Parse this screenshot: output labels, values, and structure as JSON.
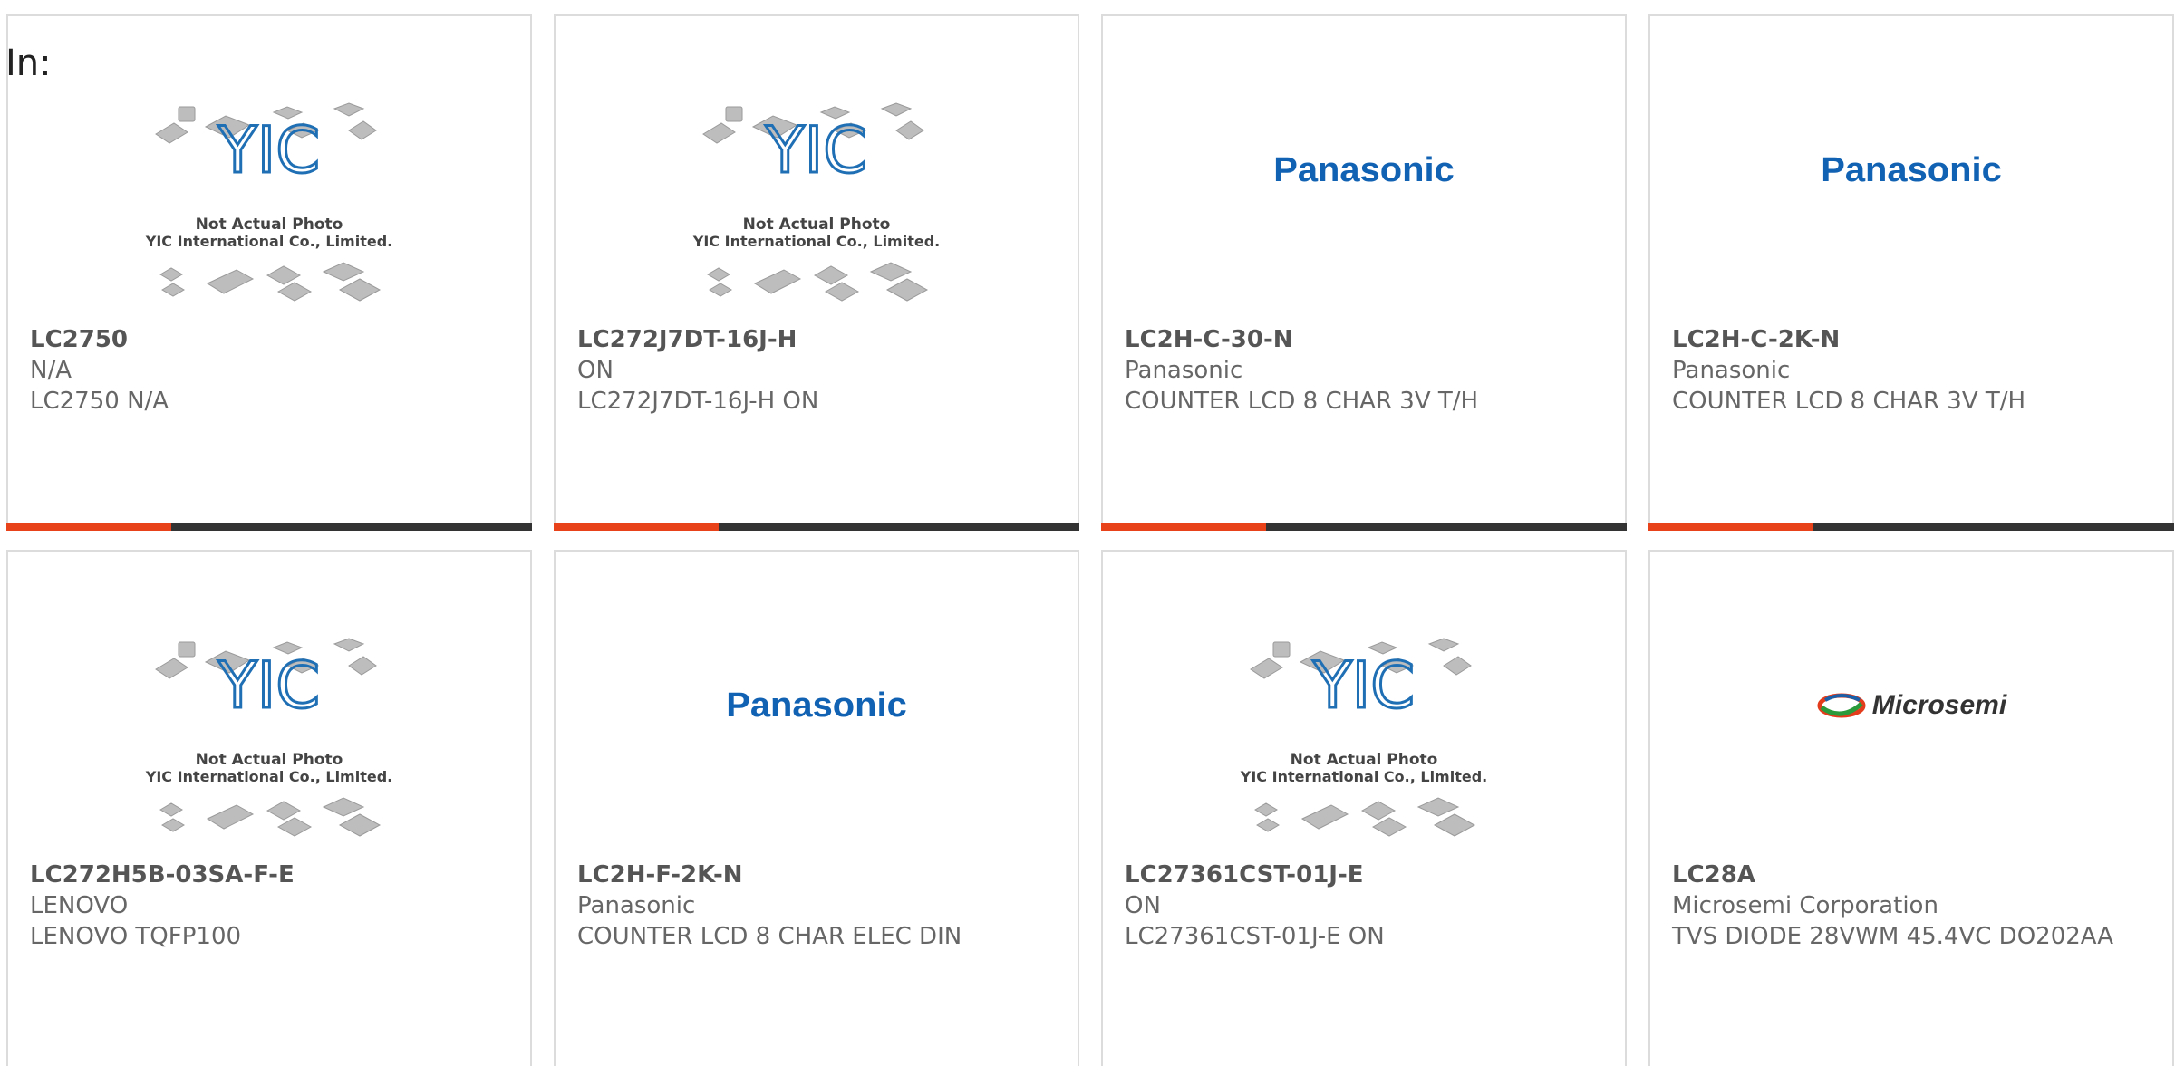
{
  "page": {
    "in_label": "In:"
  },
  "placeholder": {
    "line1": "Not Actual Photo",
    "line2": "YIC International Co., Limited."
  },
  "cards": [
    {
      "part": "LC2750",
      "mfr": "N/A",
      "desc": "LC2750 N/A",
      "logo": "yic-placeholder"
    },
    {
      "part": "LC272J7DT-16J-H",
      "mfr": "ON",
      "desc": "LC272J7DT-16J-H ON",
      "logo": "yic-placeholder"
    },
    {
      "part": "LC2H-C-30-N",
      "mfr": "Panasonic",
      "desc": "COUNTER LCD 8 CHAR 3V T/H",
      "logo": "panasonic",
      "logo_text": "Panasonic"
    },
    {
      "part": "LC2H-C-2K-N",
      "mfr": "Panasonic",
      "desc": "COUNTER LCD 8 CHAR 3V T/H",
      "logo": "panasonic",
      "logo_text": "Panasonic"
    },
    {
      "part": "LC272H5B-03SA-F-E",
      "mfr": "LENOVO",
      "desc": "LENOVO TQFP100",
      "logo": "yic-placeholder"
    },
    {
      "part": "LC2H-F-2K-N",
      "mfr": "Panasonic",
      "desc": "COUNTER LCD 8 CHAR ELEC DIN",
      "logo": "panasonic",
      "logo_text": "Panasonic"
    },
    {
      "part": "LC27361CST-01J-E",
      "mfr": "ON",
      "desc": "LC27361CST-01J-E ON",
      "logo": "yic-placeholder"
    },
    {
      "part": "LC28A",
      "mfr": "Microsemi Corporation",
      "desc": "TVS DIODE 28VWM 45.4VC DO202AA",
      "logo": "microsemi",
      "logo_text": "Microsemi"
    }
  ],
  "colors": {
    "accent": "#e8421a",
    "bar": "#333333",
    "panasonic_blue": "#1262b3",
    "yic_blue": "#1f6fb5"
  }
}
